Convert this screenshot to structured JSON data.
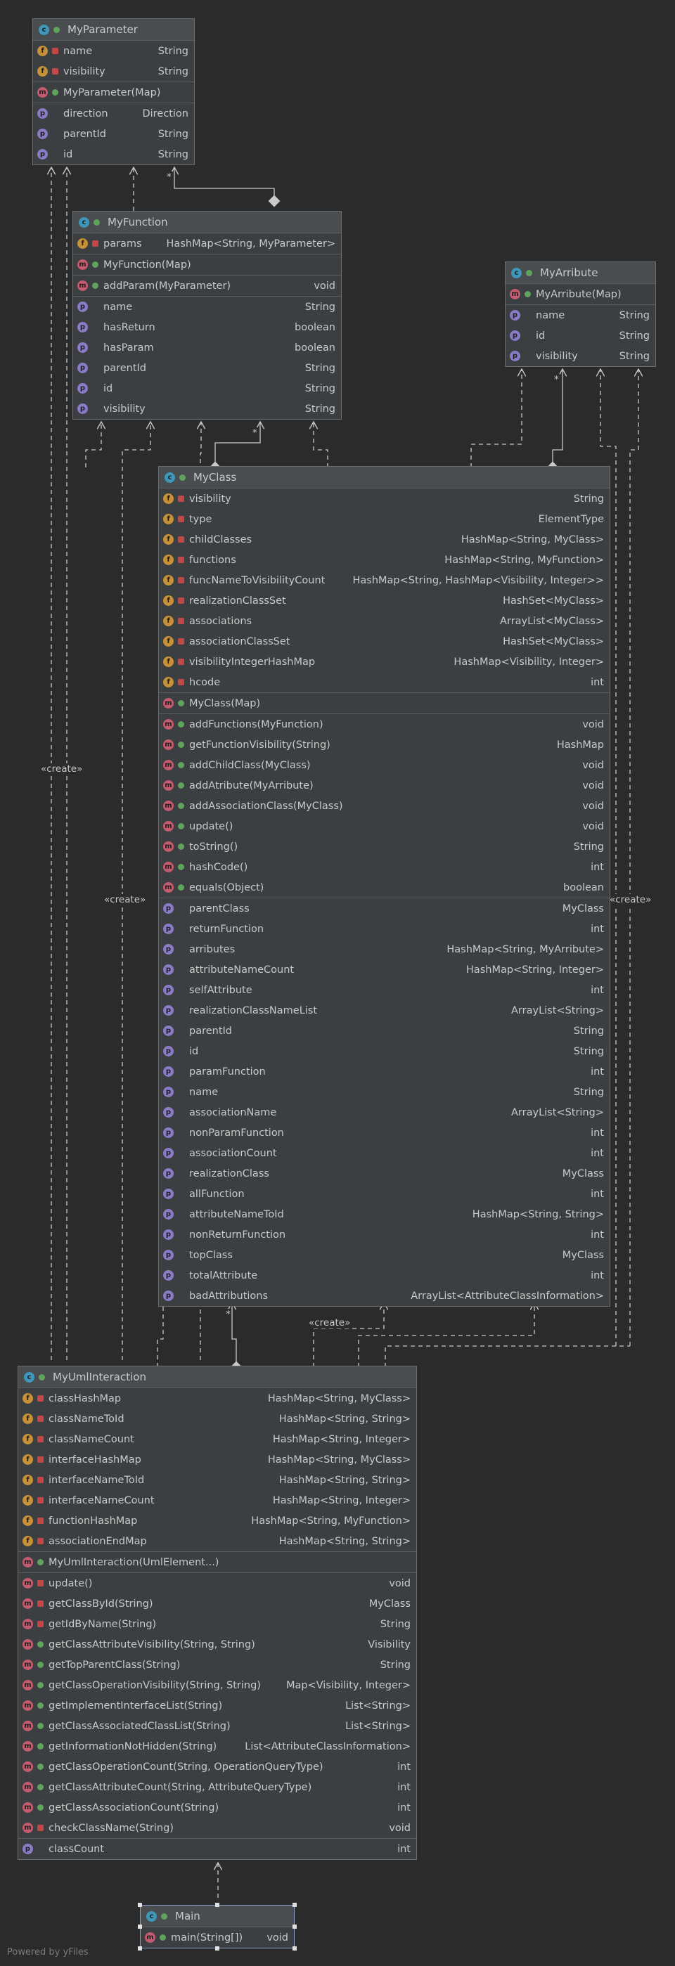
{
  "classes": {
    "myparameter": {
      "name": "MyParameter",
      "sections": [
        [
          {
            "kind": "f",
            "vis": "priv",
            "name": "name",
            "type": "String"
          },
          {
            "kind": "f",
            "vis": "priv",
            "name": "visibility",
            "type": "String"
          }
        ],
        [
          {
            "kind": "m",
            "vis": "pub",
            "name": "MyParameter(Map)",
            "type": ""
          }
        ],
        [
          {
            "kind": "p",
            "vis": "none",
            "name": "direction",
            "type": "Direction"
          },
          {
            "kind": "p",
            "vis": "none",
            "name": "parentId",
            "type": "String"
          },
          {
            "kind": "p",
            "vis": "none",
            "name": "id",
            "type": "String"
          }
        ]
      ]
    },
    "myfunction": {
      "name": "MyFunction",
      "sections": [
        [
          {
            "kind": "f",
            "vis": "priv",
            "name": "params",
            "type": "HashMap<String, MyParameter>"
          }
        ],
        [
          {
            "kind": "m",
            "vis": "pub",
            "name": "MyFunction(Map)",
            "type": ""
          }
        ],
        [
          {
            "kind": "m",
            "vis": "pub",
            "name": "addParam(MyParameter)",
            "type": "void"
          }
        ],
        [
          {
            "kind": "p",
            "vis": "none",
            "name": "name",
            "type": "String"
          },
          {
            "kind": "p",
            "vis": "none",
            "name": "hasReturn",
            "type": "boolean"
          },
          {
            "kind": "p",
            "vis": "none",
            "name": "hasParam",
            "type": "boolean"
          },
          {
            "kind": "p",
            "vis": "none",
            "name": "parentId",
            "type": "String"
          },
          {
            "kind": "p",
            "vis": "none",
            "name": "id",
            "type": "String"
          },
          {
            "kind": "p",
            "vis": "none",
            "name": "visibility",
            "type": "String"
          }
        ]
      ]
    },
    "myarribute": {
      "name": "MyArribute",
      "sections": [
        [
          {
            "kind": "m",
            "vis": "pub",
            "name": "MyArribute(Map)",
            "type": ""
          }
        ],
        [
          {
            "kind": "p",
            "vis": "none",
            "name": "name",
            "type": "String"
          },
          {
            "kind": "p",
            "vis": "none",
            "name": "id",
            "type": "String"
          },
          {
            "kind": "p",
            "vis": "none",
            "name": "visibility",
            "type": "String"
          }
        ]
      ]
    },
    "myclass": {
      "name": "MyClass",
      "sections": [
        [
          {
            "kind": "f",
            "vis": "priv",
            "name": "visibility",
            "type": "String"
          },
          {
            "kind": "f",
            "vis": "priv",
            "name": "type",
            "type": "ElementType"
          },
          {
            "kind": "f",
            "vis": "priv",
            "name": "childClasses",
            "type": "HashMap<String, MyClass>"
          },
          {
            "kind": "f",
            "vis": "priv",
            "name": "functions",
            "type": "HashMap<String, MyFunction>"
          },
          {
            "kind": "f",
            "vis": "priv",
            "name": "funcNameToVisibilityCount",
            "type": "HashMap<String, HashMap<Visibility, Integer>>"
          },
          {
            "kind": "f",
            "vis": "priv",
            "name": "realizationClassSet",
            "type": "HashSet<MyClass>"
          },
          {
            "kind": "f",
            "vis": "priv",
            "name": "associations",
            "type": "ArrayList<MyClass>"
          },
          {
            "kind": "f",
            "vis": "priv",
            "name": "associationClassSet",
            "type": "HashSet<MyClass>"
          },
          {
            "kind": "f",
            "vis": "priv",
            "name": "visibilityIntegerHashMap",
            "type": "HashMap<Visibility, Integer>"
          },
          {
            "kind": "f",
            "vis": "priv",
            "name": "hcode",
            "type": "int"
          }
        ],
        [
          {
            "kind": "m",
            "vis": "pub",
            "name": "MyClass(Map)",
            "type": ""
          }
        ],
        [
          {
            "kind": "m",
            "vis": "pub",
            "name": "addFunctions(MyFunction)",
            "type": "void"
          },
          {
            "kind": "m",
            "vis": "pub",
            "name": "getFunctionVisibility(String)",
            "type": "HashMap"
          },
          {
            "kind": "m",
            "vis": "pub",
            "name": "addChildClass(MyClass)",
            "type": "void"
          },
          {
            "kind": "m",
            "vis": "pub",
            "name": "addAtribute(MyArribute)",
            "type": "void"
          },
          {
            "kind": "m",
            "vis": "pub",
            "name": "addAssociationClass(MyClass)",
            "type": "void"
          },
          {
            "kind": "m",
            "vis": "pub",
            "name": "update()",
            "type": "void"
          },
          {
            "kind": "m",
            "vis": "pub",
            "name": "toString()",
            "type": "String"
          },
          {
            "kind": "m",
            "vis": "pub",
            "name": "hashCode()",
            "type": "int"
          },
          {
            "kind": "m",
            "vis": "pub",
            "name": "equals(Object)",
            "type": "boolean"
          }
        ],
        [
          {
            "kind": "p",
            "vis": "none",
            "name": "parentClass",
            "type": "MyClass"
          },
          {
            "kind": "p",
            "vis": "none",
            "name": "returnFunction",
            "type": "int"
          },
          {
            "kind": "p",
            "vis": "none",
            "name": "arributes",
            "type": "HashMap<String, MyArribute>"
          },
          {
            "kind": "p",
            "vis": "none",
            "name": "attributeNameCount",
            "type": "HashMap<String, Integer>"
          },
          {
            "kind": "p",
            "vis": "none",
            "name": "selfAttribute",
            "type": "int"
          },
          {
            "kind": "p",
            "vis": "none",
            "name": "realizationClassNameList",
            "type": "ArrayList<String>"
          },
          {
            "kind": "p",
            "vis": "none",
            "name": "parentId",
            "type": "String"
          },
          {
            "kind": "p",
            "vis": "none",
            "name": "id",
            "type": "String"
          },
          {
            "kind": "p",
            "vis": "none",
            "name": "paramFunction",
            "type": "int"
          },
          {
            "kind": "p",
            "vis": "none",
            "name": "name",
            "type": "String"
          },
          {
            "kind": "p",
            "vis": "none",
            "name": "associationName",
            "type": "ArrayList<String>"
          },
          {
            "kind": "p",
            "vis": "none",
            "name": "nonParamFunction",
            "type": "int"
          },
          {
            "kind": "p",
            "vis": "none",
            "name": "associationCount",
            "type": "int"
          },
          {
            "kind": "p",
            "vis": "none",
            "name": "realizationClass",
            "type": "MyClass"
          },
          {
            "kind": "p",
            "vis": "none",
            "name": "allFunction",
            "type": "int"
          },
          {
            "kind": "p",
            "vis": "none",
            "name": "attributeNameToId",
            "type": "HashMap<String, String>"
          },
          {
            "kind": "p",
            "vis": "none",
            "name": "nonReturnFunction",
            "type": "int"
          },
          {
            "kind": "p",
            "vis": "none",
            "name": "topClass",
            "type": "MyClass"
          },
          {
            "kind": "p",
            "vis": "none",
            "name": "totalAttribute",
            "type": "int"
          },
          {
            "kind": "p",
            "vis": "none",
            "name": "badAttributions",
            "type": "ArrayList<AttributeClassInformation>"
          }
        ]
      ]
    },
    "myumlinteraction": {
      "name": "MyUmlInteraction",
      "sections": [
        [
          {
            "kind": "f",
            "vis": "priv",
            "name": "classHashMap",
            "type": "HashMap<String, MyClass>"
          },
          {
            "kind": "f",
            "vis": "priv",
            "name": "classNameToId",
            "type": "HashMap<String, String>"
          },
          {
            "kind": "f",
            "vis": "priv",
            "name": "classNameCount",
            "type": "HashMap<String, Integer>"
          },
          {
            "kind": "f",
            "vis": "priv",
            "name": "interfaceHashMap",
            "type": "HashMap<String, MyClass>"
          },
          {
            "kind": "f",
            "vis": "priv",
            "name": "interfaceNameToId",
            "type": "HashMap<String, String>"
          },
          {
            "kind": "f",
            "vis": "priv",
            "name": "interfaceNameCount",
            "type": "HashMap<String, Integer>"
          },
          {
            "kind": "f",
            "vis": "priv",
            "name": "functionHashMap",
            "type": "HashMap<String, MyFunction>"
          },
          {
            "kind": "f",
            "vis": "priv",
            "name": "associationEndMap",
            "type": "HashMap<String, String>"
          }
        ],
        [
          {
            "kind": "m",
            "vis": "pub",
            "name": "MyUmlInteraction(UmlElement...)",
            "type": ""
          }
        ],
        [
          {
            "kind": "m",
            "vis": "priv",
            "name": "update()",
            "type": "void"
          },
          {
            "kind": "m",
            "vis": "priv",
            "name": "getClassById(String)",
            "type": "MyClass"
          },
          {
            "kind": "m",
            "vis": "priv",
            "name": "getIdByName(String)",
            "type": "String"
          },
          {
            "kind": "m",
            "vis": "pub",
            "name": "getClassAttributeVisibility(String, String)",
            "type": "Visibility"
          },
          {
            "kind": "m",
            "vis": "pub",
            "name": "getTopParentClass(String)",
            "type": "String"
          },
          {
            "kind": "m",
            "vis": "pub",
            "name": "getClassOperationVisibility(String, String)",
            "type": "Map<Visibility, Integer>"
          },
          {
            "kind": "m",
            "vis": "pub",
            "name": "getImplementInterfaceList(String)",
            "type": "List<String>"
          },
          {
            "kind": "m",
            "vis": "pub",
            "name": "getClassAssociatedClassList(String)",
            "type": "List<String>"
          },
          {
            "kind": "m",
            "vis": "pub",
            "name": "getInformationNotHidden(String)",
            "type": "List<AttributeClassInformation>"
          },
          {
            "kind": "m",
            "vis": "pub",
            "name": "getClassOperationCount(String, OperationQueryType)",
            "type": "int"
          },
          {
            "kind": "m",
            "vis": "pub",
            "name": "getClassAttributeCount(String, AttributeQueryType)",
            "type": "int"
          },
          {
            "kind": "m",
            "vis": "pub",
            "name": "getClassAssociationCount(String)",
            "type": "int"
          },
          {
            "kind": "m",
            "vis": "priv",
            "name": "checkClassName(String)",
            "type": "void"
          }
        ],
        [
          {
            "kind": "p",
            "vis": "none",
            "name": "classCount",
            "type": "int"
          }
        ]
      ]
    },
    "main": {
      "name": "Main",
      "sections": [
        [
          {
            "kind": "m",
            "vis": "pub",
            "name": "main(String[])",
            "type": "void"
          }
        ]
      ]
    }
  },
  "labels": {
    "create": "«create»",
    "star": "*"
  },
  "footer": "Powered by yFiles"
}
